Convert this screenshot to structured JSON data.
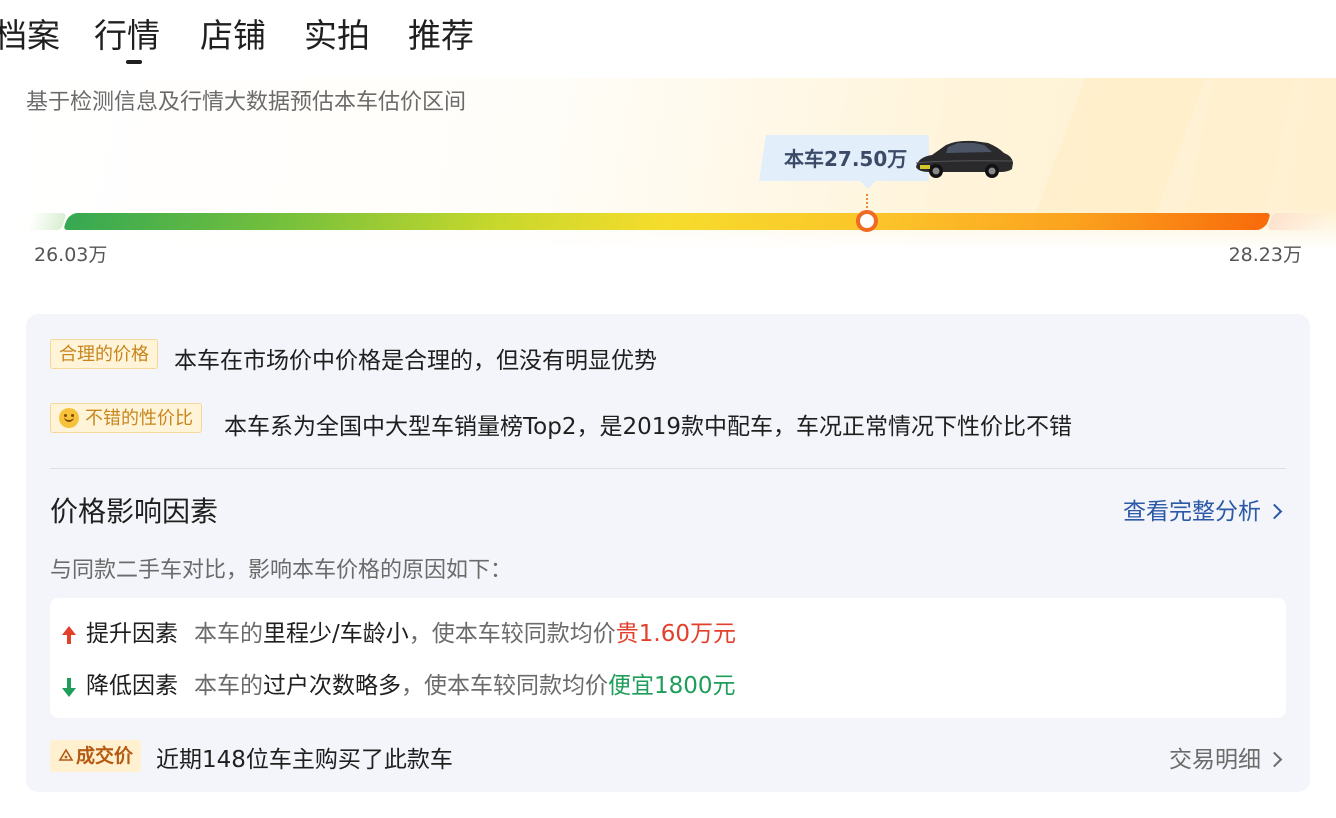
{
  "tabs": [
    {
      "label": "档案",
      "active": false
    },
    {
      "label": "行情",
      "active": true
    },
    {
      "label": "店铺",
      "active": false
    },
    {
      "label": "实拍",
      "active": false
    },
    {
      "label": "推荐",
      "active": false
    }
  ],
  "valuation": {
    "description": "基于检测信息及行情大数据预估本车估价区间",
    "current_label": "本车27.50万",
    "min_label": "26.03万",
    "max_label": "28.23万",
    "range_min": 26.03,
    "range_max": 28.23,
    "current": 27.5
  },
  "summary": [
    {
      "tag": "合理的价格",
      "text": "本车在市场价中价格是合理的，但没有明显优势",
      "icon": null
    },
    {
      "tag": "不错的性价比",
      "text": "本车系为全国中大型车销量榜Top2，是2019款中配车，车况正常情况下性价比不错",
      "icon": "smiley-icon"
    }
  ],
  "factors_section": {
    "title": "价格影响因素",
    "link": "查看完整分析",
    "description": "与同款二手车对比，影响本车价格的原因如下：",
    "items": [
      {
        "direction": "up",
        "icon": "arrow-up-icon",
        "label": "提升因素",
        "pre": "本车的",
        "highlight": "里程少/车龄小",
        "mid": "，使本车较同款均价",
        "value": "贵1.60万元",
        "color": "#e2402b"
      },
      {
        "direction": "down",
        "icon": "arrow-down-icon",
        "label": "降低因素",
        "pre": "本车的",
        "highlight": "过户次数略多",
        "mid": "，使本车较同款均价",
        "value": "便宜1800元",
        "color": "#1e9e5a"
      }
    ]
  },
  "deals": {
    "tag": "成交价",
    "text": "近期148位车主购买了此款车",
    "link": "交易明细"
  }
}
